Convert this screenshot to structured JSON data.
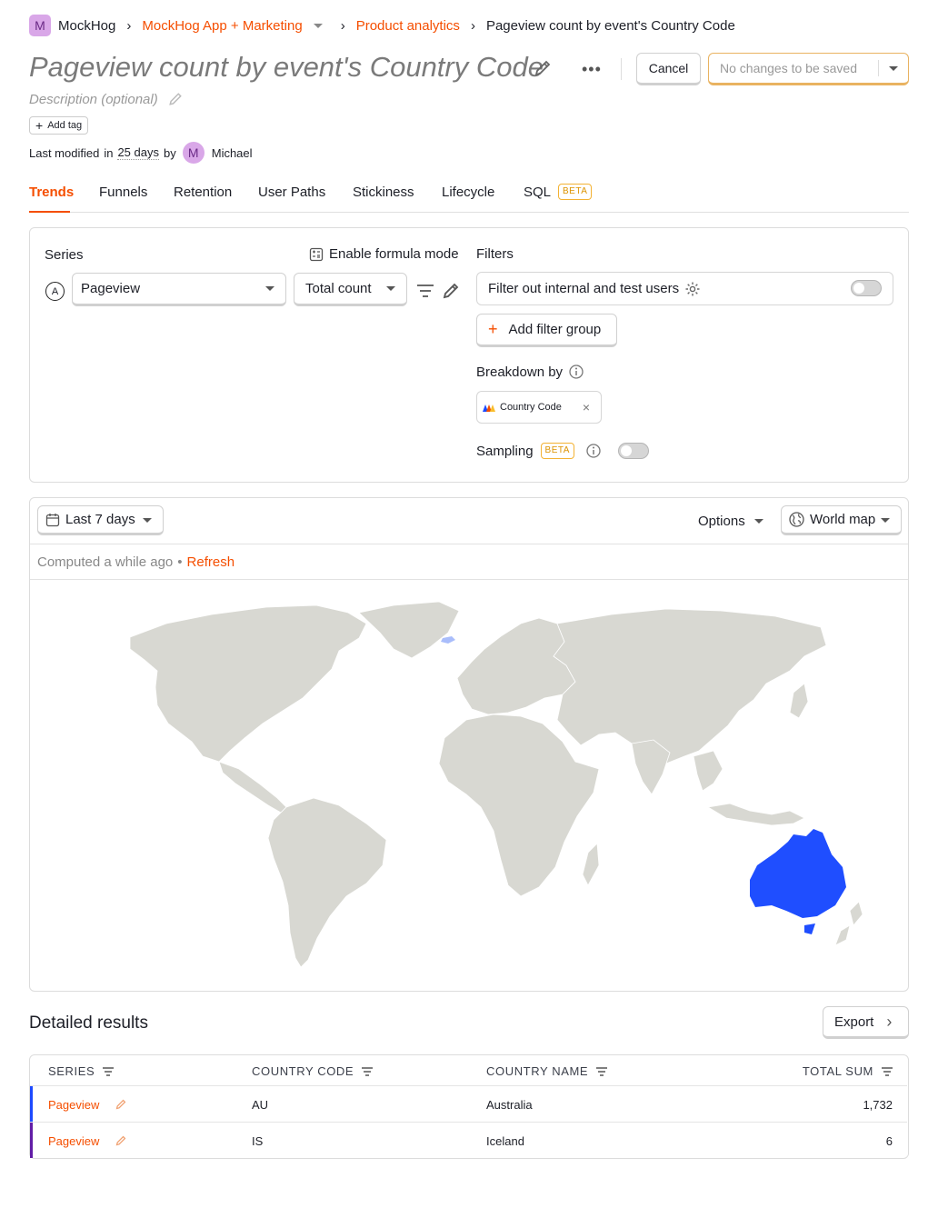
{
  "breadcrumb": {
    "org_initial": "M",
    "org": "MockHog",
    "project": "MockHog App + Marketing",
    "section": "Product analytics",
    "current": "Pageview count by event's Country Code"
  },
  "insight": {
    "title": "Pageview count by event's Country Code",
    "description_placeholder": "Description (optional)",
    "add_tag": "Add tag",
    "modified_prefix": "Last modified",
    "modified_in": "in",
    "modified_ago": "25 days",
    "modified_by": "by",
    "user_initial": "M",
    "user_name": "Michael"
  },
  "header_actions": {
    "cancel": "Cancel",
    "save_status": "No changes to be saved"
  },
  "tabs": [
    {
      "label": "Trends",
      "active": true
    },
    {
      "label": "Funnels"
    },
    {
      "label": "Retention"
    },
    {
      "label": "User Paths"
    },
    {
      "label": "Stickiness"
    },
    {
      "label": "Lifecycle"
    },
    {
      "label": "SQL",
      "badge": "BETA"
    }
  ],
  "series_panel": {
    "heading": "Series",
    "formula_mode": "Enable formula mode",
    "series_letter": "A",
    "event": "Pageview",
    "aggregation": "Total count"
  },
  "filters_panel": {
    "heading": "Filters",
    "internal_filter": "Filter out internal and test users",
    "add_filter_group": "Add filter group",
    "breakdown_heading": "Breakdown by",
    "breakdown_value": "Country Code",
    "sampling_label": "Sampling",
    "sampling_badge": "BETA"
  },
  "results_toolbar": {
    "date_range": "Last 7 days",
    "options": "Options",
    "display": "World map",
    "computed": "Computed a while ago",
    "separator": "•",
    "refresh": "Refresh"
  },
  "map": {
    "highlight_color": "#1f4eff",
    "land_color": "#d8d8d2",
    "highlighted_countries": [
      "Australia",
      "Iceland"
    ]
  },
  "detailed": {
    "heading": "Detailed results",
    "export": "Export",
    "columns": [
      "SERIES",
      "COUNTRY CODE",
      "COUNTRY NAME",
      "TOTAL SUM"
    ],
    "rows": [
      {
        "series": "Pageview",
        "code": "AU",
        "name": "Australia",
        "total": "1,732",
        "color": "#1d4aff"
      },
      {
        "series": "Pageview",
        "code": "IS",
        "name": "Iceland",
        "total": "6",
        "color": "#621da6"
      }
    ]
  }
}
